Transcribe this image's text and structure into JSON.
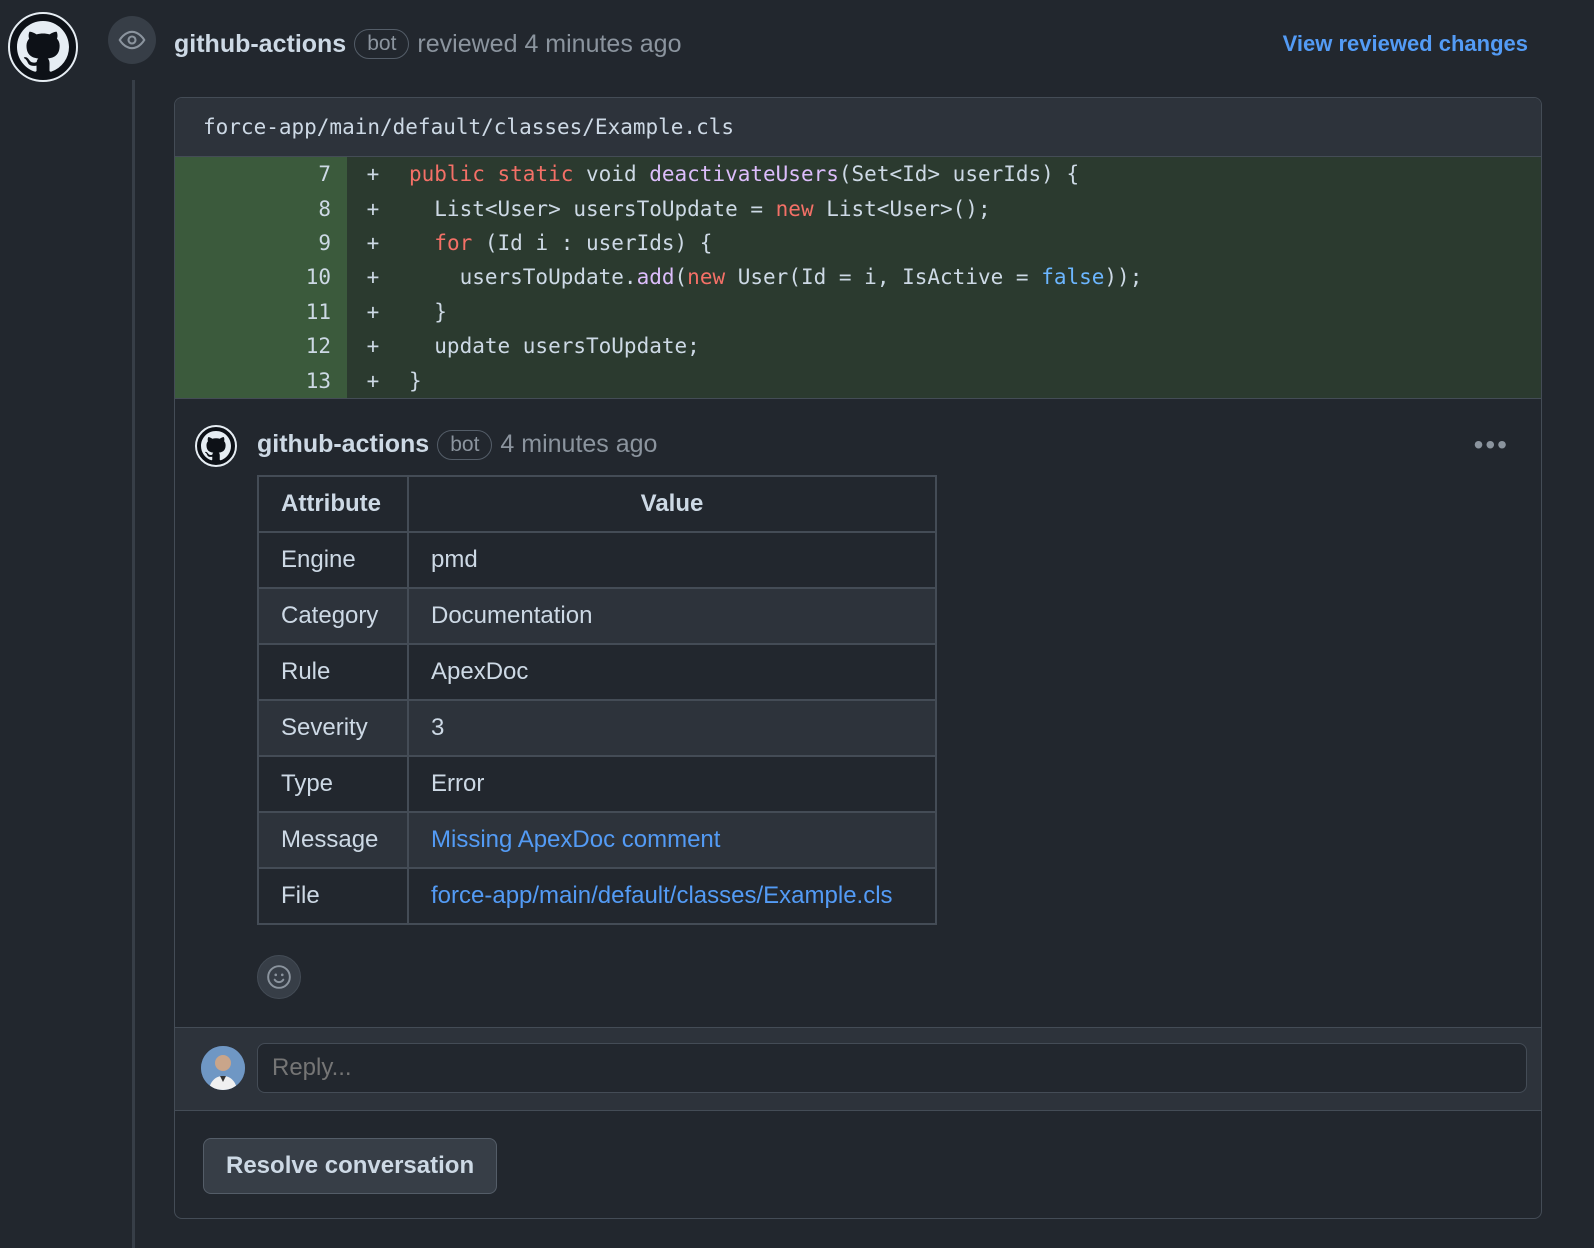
{
  "review": {
    "author": "github-actions",
    "badge": "bot",
    "action": "reviewed",
    "time": "4 minutes ago",
    "view_link": "View reviewed changes"
  },
  "file": {
    "path": "force-app/main/default/classes/Example.cls",
    "lines": [
      {
        "num": "7",
        "sign": "+"
      },
      {
        "num": "8",
        "sign": "+"
      },
      {
        "num": "9",
        "sign": "+"
      },
      {
        "num": "10",
        "sign": "+"
      },
      {
        "num": "11",
        "sign": "+"
      },
      {
        "num": "12",
        "sign": "+"
      },
      {
        "num": "13",
        "sign": "+"
      }
    ],
    "code": {
      "l7": {
        "kw1": "public",
        "kw2": "static",
        "t1": " void ",
        "fn": "deactivateUsers",
        "t2": "(Set<Id> userIds) {"
      },
      "l8": {
        "t1": "  List<User> usersToUpdate = ",
        "kw": "new",
        "t2": " List<User>();"
      },
      "l9": {
        "kw": "for",
        "t1": " (Id i : userIds) {"
      },
      "l10": {
        "t1": "    usersToUpdate.",
        "fn": "add",
        "t2": "(",
        "kw": "new",
        "t3": " User(Id = i, IsActive = ",
        "bool": "false",
        "t4": "));"
      },
      "l11": {
        "t1": "  }"
      },
      "l12": {
        "t1": "  update usersToUpdate;"
      },
      "l13": {
        "t1": "}"
      }
    }
  },
  "comment": {
    "author": "github-actions",
    "badge": "bot",
    "time": "4 minutes ago",
    "menu": "•••",
    "table": {
      "headers": [
        "Attribute",
        "Value"
      ],
      "rows": [
        {
          "attr": "Engine",
          "value": "pmd"
        },
        {
          "attr": "Category",
          "value": "Documentation"
        },
        {
          "attr": "Rule",
          "value": "ApexDoc"
        },
        {
          "attr": "Severity",
          "value": "3"
        },
        {
          "attr": "Type",
          "value": "Error"
        },
        {
          "attr": "Message",
          "value": "Missing ApexDoc comment"
        },
        {
          "attr": "File",
          "value": "force-app/main/default/classes/Example.cls"
        }
      ]
    }
  },
  "reply": {
    "placeholder": "Reply..."
  },
  "resolve_label": "Resolve conversation",
  "colors": {
    "accent": "#539bf5",
    "keyword": "#f47067",
    "function": "#dcbdfb",
    "addition_bg": "#2b3a2f"
  }
}
